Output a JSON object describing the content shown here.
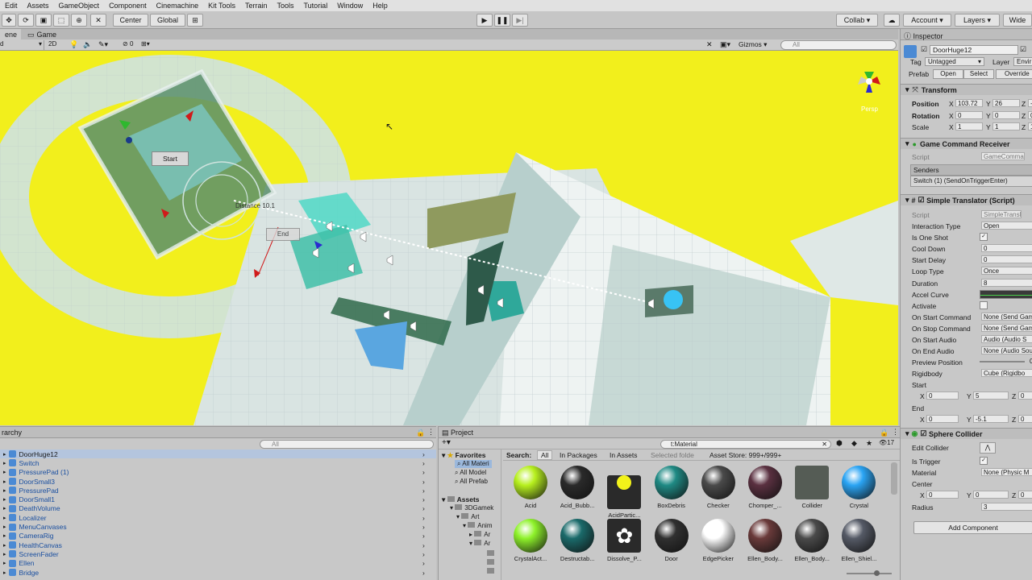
{
  "menu": [
    "Edit",
    "Assets",
    "GameObject",
    "Component",
    "Cinemachine",
    "Kit Tools",
    "Terrain",
    "Tools",
    "Tutorial",
    "Window",
    "Help"
  ],
  "toolbar": {
    "center": "Center",
    "global": "Global",
    "collab": "Collab",
    "account": "Account",
    "layers": "Layers",
    "layout": "Wide"
  },
  "tabs": {
    "scene": "ene",
    "game": "Game"
  },
  "scenebar": {
    "shading": "d",
    "mode2d": "2D",
    "fx_count": "0",
    "gizmos": "Gizmos",
    "search_placeholder": "All"
  },
  "scene": {
    "start_label": "Start",
    "end_label": "End",
    "distance_label": "Distance 10.1",
    "persp_label": "Persp"
  },
  "hierarchy": {
    "title": "rarchy",
    "search_placeholder": "All",
    "items": [
      "DoorHuge12",
      "Switch",
      "PressurePad (1)",
      "DoorSmall3",
      "PressurePad",
      "DoorSmall1",
      "DeathVolume",
      "Localizer",
      "MenuCanvases",
      "CameraRig",
      "HealthCanvas",
      "ScreenFader",
      "Ellen",
      "Bridge"
    ]
  },
  "project": {
    "title": "Project",
    "search_value": "t:Material",
    "count": "17",
    "favorites_title": "Favorites",
    "favorites": [
      "All Materi",
      "All Model",
      "All Prefab"
    ],
    "assets_title": "Assets",
    "tree": [
      "3DGamek",
      "Art",
      "Anim",
      "Ar",
      "Ar"
    ],
    "search_label": "Search:",
    "scopes": [
      "All",
      "In Packages",
      "In Assets",
      "Selected folde",
      "Asset Store: 999+/999+"
    ],
    "assets": [
      {
        "name": "Acid",
        "color": "#b7f01e"
      },
      {
        "name": "Acid_Bubb...",
        "color": "#2a2a2a"
      },
      {
        "name": "AcidPartic...",
        "color": "#f2f21a"
      },
      {
        "name": "BoxDebris",
        "color": "#1f8a84"
      },
      {
        "name": "Checker",
        "color": "#4a4a4a"
      },
      {
        "name": "Chomper_...",
        "color": "#5a3040"
      },
      {
        "name": "Collider",
        "color": "#4a5a4a"
      },
      {
        "name": "Crystal",
        "color": "#2aa4f4"
      },
      {
        "name": "CrystalAct...",
        "color": "#8ef22a"
      },
      {
        "name": "Destructab...",
        "color": "#1a6a6a"
      },
      {
        "name": "Dissolve_P...",
        "color": "#ffffff"
      },
      {
        "name": "Door",
        "color": "#303030"
      },
      {
        "name": "EdgePicker",
        "color": "#ffffff"
      },
      {
        "name": "Ellen_Body...",
        "color": "#6a3a3a"
      },
      {
        "name": "Ellen_Body...",
        "color": "#4a4a4a"
      },
      {
        "name": "Ellen_Shiel...",
        "color": "#555a66"
      }
    ]
  },
  "inspector": {
    "title": "Inspector",
    "object_name": "DoorHuge12",
    "tag_label": "Tag",
    "tag_value": "Untagged",
    "layer_label": "Layer",
    "layer_value": "Envir",
    "prefab_label": "Prefab",
    "prefab_open": "Open",
    "prefab_select": "Select",
    "prefab_override": "Override",
    "transform": {
      "title": "Transform",
      "position_label": "Position",
      "pos_x": "103.72",
      "pos_y": "26",
      "pos_z": "-",
      "rotation_label": "Rotation",
      "rot_x": "0",
      "rot_y": "0",
      "rot_z": "0",
      "scale_label": "Scale",
      "sc_x": "1",
      "sc_y": "1",
      "sc_z": "1"
    },
    "gcr": {
      "title": "Game Command Receiver",
      "script_label": "Script",
      "script_value": "GameComma",
      "senders_label": "Senders",
      "sender_item": "Switch (1) (SendOnTriggerEnter)"
    },
    "st": {
      "title": "Simple Translator (Script)",
      "script_label": "Script",
      "script_value": "SimpleTransl",
      "rows": [
        {
          "label": "Interaction Type",
          "value": "Open"
        },
        {
          "label": "Is One Shot",
          "value": "✓"
        },
        {
          "label": "Cool Down",
          "value": "0"
        },
        {
          "label": "Start Delay",
          "value": "0"
        },
        {
          "label": "Loop Type",
          "value": "Once"
        },
        {
          "label": "Duration",
          "value": "8"
        },
        {
          "label": "Accel Curve",
          "value": ""
        },
        {
          "label": "Activate",
          "value": ""
        },
        {
          "label": "On Start Command",
          "value": "None (Send Gam"
        },
        {
          "label": "On Stop Command",
          "value": "None (Send Gam"
        },
        {
          "label": "On Start Audio",
          "value": "Audio (Audio S"
        },
        {
          "label": "On End Audio",
          "value": "None (Audio Sou"
        },
        {
          "label": "Preview Position",
          "value": "0"
        },
        {
          "label": "Rigidbody",
          "value": "Cube (Rigidbo"
        }
      ],
      "start_label": "Start",
      "start_x": "0",
      "start_y": "5",
      "start_z": "0",
      "end_label": "End",
      "end_x": "0",
      "end_y": "-5.1",
      "end_z": "0"
    },
    "sc": {
      "title": "Sphere Collider",
      "edit_label": "Edit Collider",
      "trigger_label": "Is Trigger",
      "trigger_value": "✓",
      "material_label": "Material",
      "material_value": "None (Physic M",
      "center_label": "Center",
      "cx": "0",
      "cy": "0",
      "cz": "0",
      "radius_label": "Radius",
      "radius_value": "3"
    },
    "add_component": "Add Component"
  }
}
